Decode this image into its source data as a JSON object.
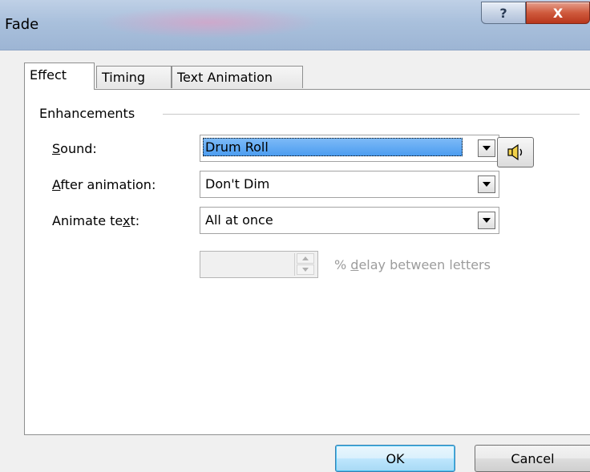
{
  "window": {
    "title": "Fade",
    "help_label": "?",
    "close_label": "X"
  },
  "tabs": [
    {
      "label": "Effect",
      "active": true
    },
    {
      "label": "Timing",
      "active": false
    },
    {
      "label": "Text Animation",
      "active": false
    }
  ],
  "enhancements": {
    "group_title": "Enhancements",
    "sound": {
      "label_pre": "",
      "label_mnemonic": "S",
      "label_post": "ound:",
      "value": "Drum Roll"
    },
    "after_animation": {
      "label_pre": "",
      "label_mnemonic": "A",
      "label_post": "fter animation:",
      "value": "Don't Dim"
    },
    "animate_text": {
      "label_pre": "Animate te",
      "label_mnemonic": "x",
      "label_post": "t:",
      "value": "All at once"
    },
    "delay": {
      "value": "",
      "label_pre": "% ",
      "label_mnemonic": "d",
      "label_post": "elay between letters",
      "enabled": false
    },
    "sound_button_icon": "speaker-icon"
  },
  "footer": {
    "ok_label": "OK",
    "cancel_label": "Cancel"
  },
  "colors": {
    "selection": "#3399ff",
    "close_button": "#c8452a",
    "titlebar": "#a9c0dc"
  }
}
